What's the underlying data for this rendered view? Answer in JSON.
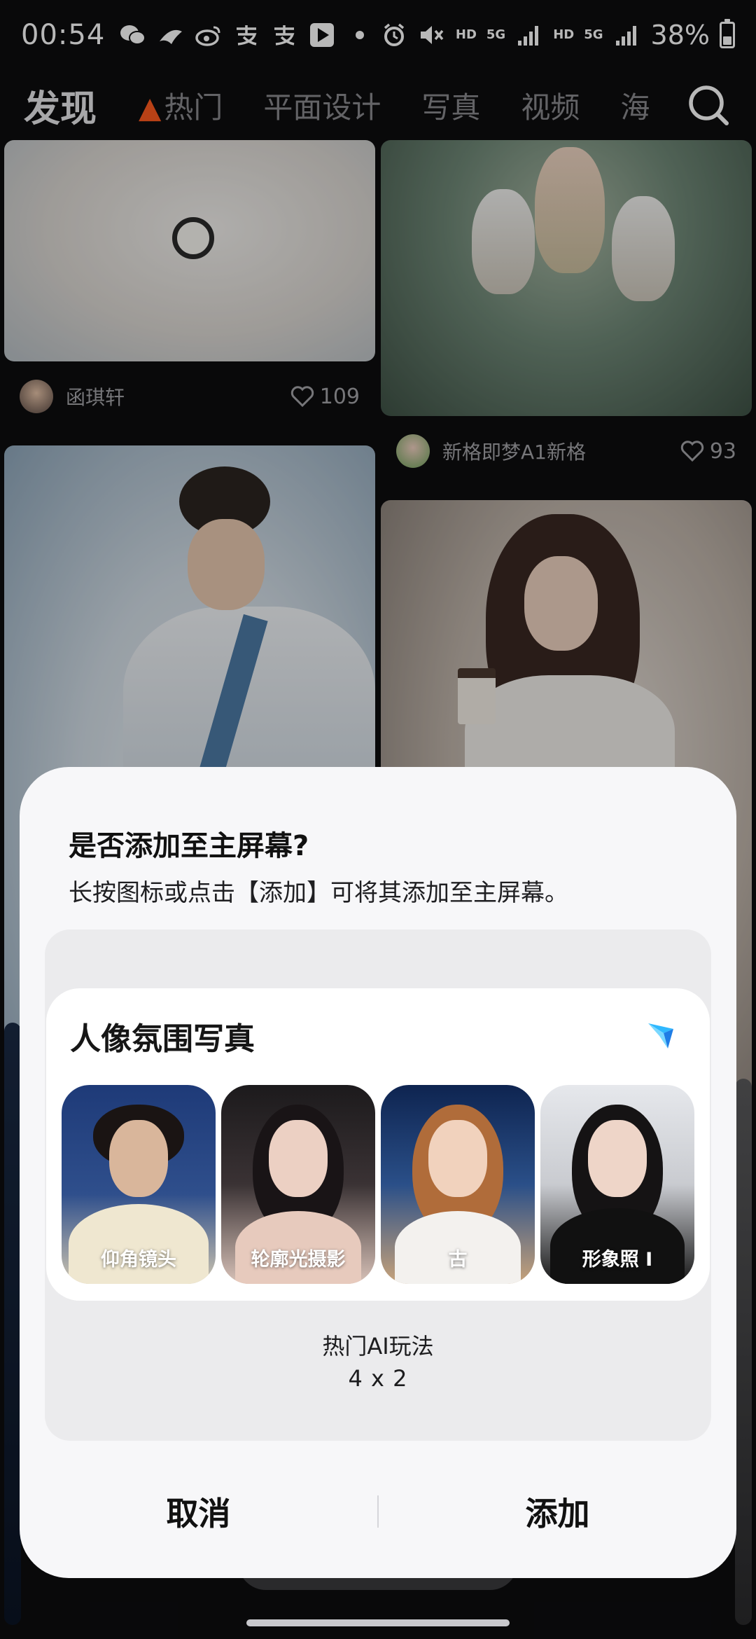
{
  "status_bar": {
    "time": "00:54",
    "network_hd_1": "HD",
    "network_5g_1": "5G",
    "network_hd_2": "HD",
    "network_5g_2": "5G",
    "battery": "38%",
    "battery_level": 0.38,
    "left_icons": [
      "wechat-icon",
      "wechat-icon",
      "taobao-icon",
      "weibo-icon",
      "alipay-icon",
      "alipay-icon",
      "play-store-icon",
      "dot-icon"
    ],
    "right_icons": [
      "alarm-icon",
      "mute-icon",
      "signal-icon",
      "signal-icon",
      "battery-charging-icon"
    ]
  },
  "nav": {
    "tabs": [
      {
        "label": "发现",
        "active": true
      },
      {
        "label": "热门",
        "hot": true
      },
      {
        "label": "平面设计"
      },
      {
        "label": "写真"
      },
      {
        "label": "视频"
      },
      {
        "label": "海"
      }
    ],
    "search_icon": "search-icon"
  },
  "feed": {
    "posts": [
      {
        "author": "函琪轩",
        "likes": "109"
      },
      {
        "author": "新格即梦A1新格",
        "likes": "93"
      }
    ]
  },
  "dialog": {
    "title": "是否添加至主屏幕?",
    "description": "长按图标或点击【添加】可将其添加至主屏幕。",
    "widget": {
      "title": "人像氛围写真",
      "logo_icon": "jimeng-logo-icon",
      "thumbnails": [
        {
          "caption": "仰角镜头"
        },
        {
          "caption": "轮廓光摄影"
        },
        {
          "caption": "古"
        },
        {
          "caption": "形象照 I"
        }
      ],
      "name": "热门AI玩法",
      "size": "4 x 2"
    },
    "cancel_label": "取消",
    "add_label": "添加"
  },
  "colors": {
    "background": "#0d0d0f",
    "sheet": "#f7f7f9",
    "preview": "#ebebed",
    "hot_flame": "#ff5a1f"
  }
}
